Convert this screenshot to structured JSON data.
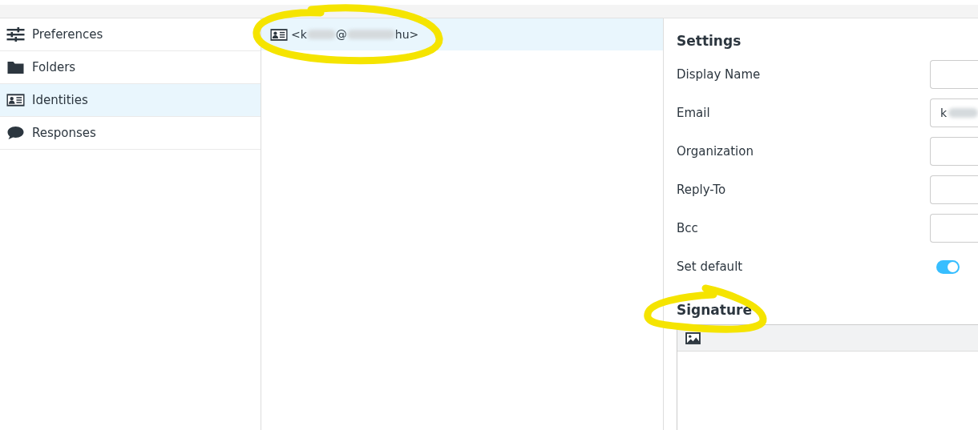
{
  "sidebar": {
    "items": [
      {
        "label": "Preferences",
        "kind": "sliders",
        "selected": false
      },
      {
        "label": "Folders",
        "kind": "folder",
        "selected": false
      },
      {
        "label": "Identities",
        "kind": "idcard",
        "selected": true
      },
      {
        "label": "Responses",
        "kind": "speech",
        "selected": false
      }
    ]
  },
  "identities": [
    {
      "parts": [
        "<k",
        "@",
        "hu>"
      ],
      "selected": true
    }
  ],
  "settings": {
    "title": "Settings",
    "fields": [
      {
        "label": "Display Name",
        "kind": "input"
      },
      {
        "label": "Email",
        "kind": "input",
        "value": "k",
        "blurred": true
      },
      {
        "label": "Organization",
        "kind": "input"
      },
      {
        "label": "Reply-To",
        "kind": "input"
      },
      {
        "label": "Bcc",
        "kind": "input"
      },
      {
        "label": "Set default",
        "kind": "toggle",
        "on": true
      }
    ]
  },
  "signature": {
    "title": "Signature"
  }
}
